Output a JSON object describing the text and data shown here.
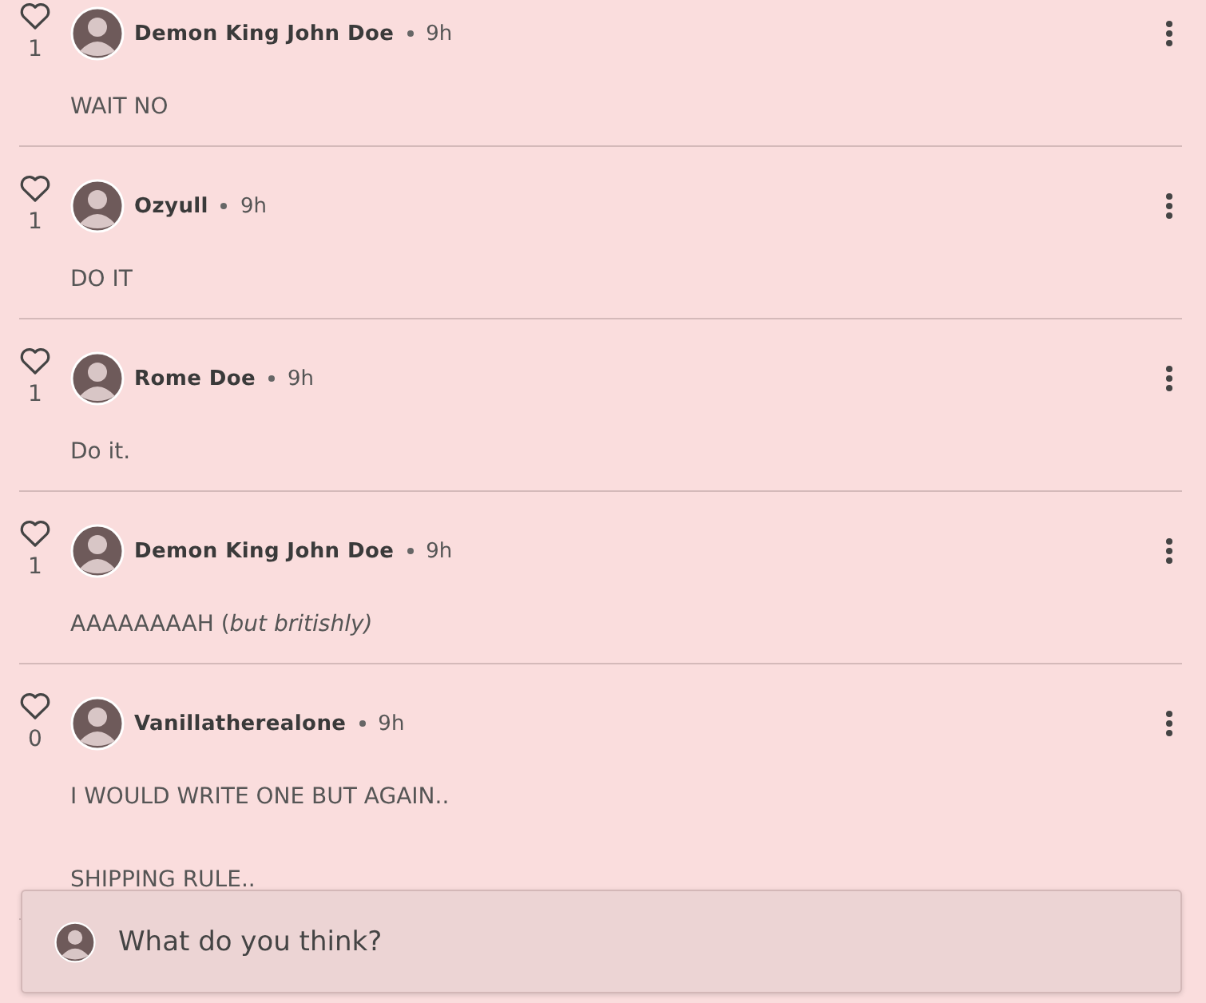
{
  "comments": [
    {
      "author": "Demon King John Doe",
      "time": "9h",
      "likes": "1",
      "paragraphs": [
        "WAIT NO"
      ]
    },
    {
      "author": "Ozyull",
      "time": "9h",
      "likes": "1",
      "paragraphs": [
        "DO IT"
      ]
    },
    {
      "author": "Rome Doe",
      "time": "9h",
      "likes": "1",
      "paragraphs": [
        "Do it."
      ]
    },
    {
      "author": "Demon King John Doe",
      "time": "9h",
      "likes": "1",
      "paragraphs": [
        "AAAAAAAAH (*but britishly)*"
      ]
    },
    {
      "author": "Vanillatherealone",
      "time": "9h",
      "likes": "0",
      "paragraphs": [
        "I WOULD WRITE ONE BUT AGAIN..",
        "SHIPPING RULE.."
      ]
    }
  ],
  "composer": {
    "placeholder": "What do you think?"
  }
}
